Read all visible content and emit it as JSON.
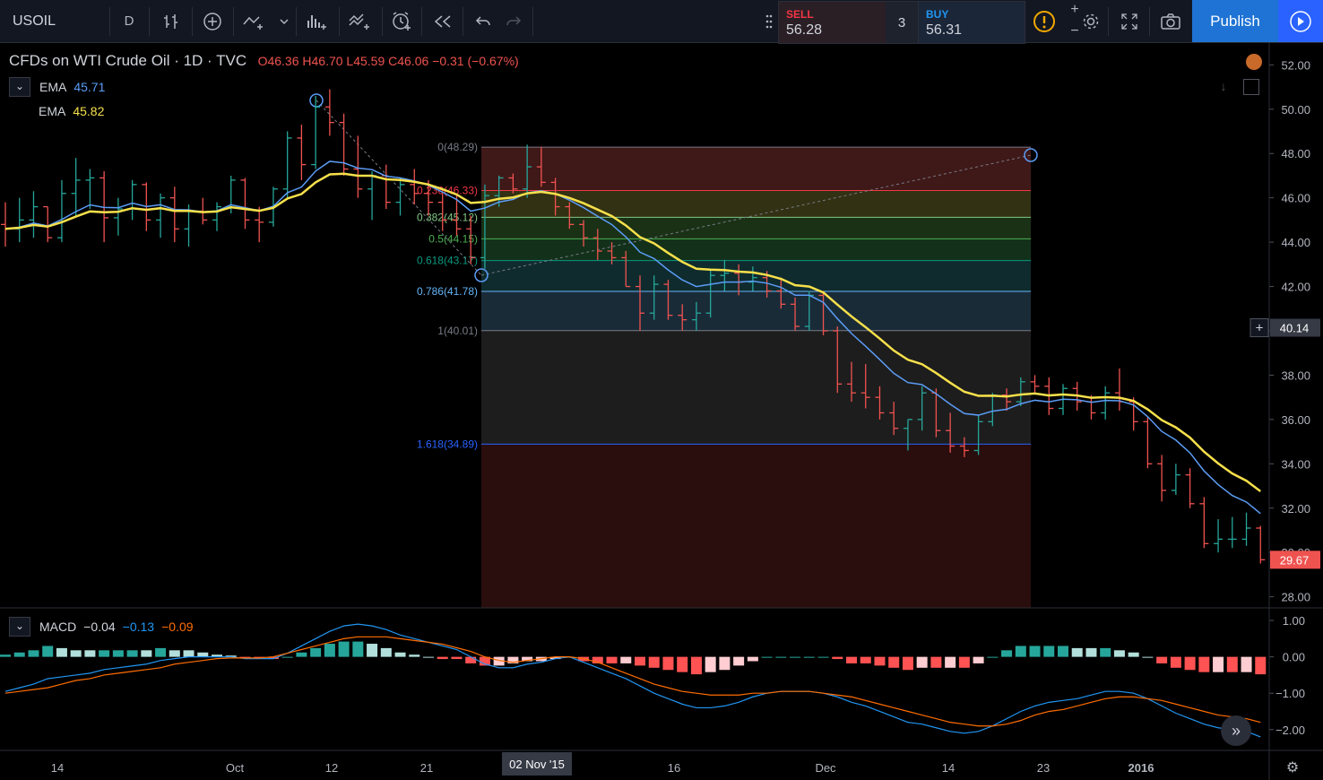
{
  "toolbar": {
    "symbol": "USOIL",
    "interval": "D",
    "sell_label": "SELL",
    "sell_price": "56.28",
    "buy_label": "BUY",
    "buy_price": "56.31",
    "quantity": "3",
    "publish_label": "Publish",
    "icons": [
      "bar-style-icon",
      "add-indicator-icon",
      "compare-icon",
      "indicators-icon",
      "templates-icon",
      "alert-icon",
      "replay-icon",
      "undo-icon",
      "redo-icon",
      "info-icon",
      "settings-icon",
      "fullscreen-icon",
      "camera-icon",
      "play-icon"
    ]
  },
  "legend": {
    "title": "CFDs on WTI Crude Oil · 1D · TVC",
    "ohlc": "O46.36 H46.70 L45.59 C46.06 −0.31 (−0.67%)",
    "ema1_label": "EMA",
    "ema1_value": "45.71",
    "ema2_label": "EMA",
    "ema2_value": "45.82",
    "macd_label": "MACD",
    "macd_v1": "−0.04",
    "macd_v2": "−0.13",
    "macd_v3": "−0.09"
  },
  "price_axis": {
    "ticks": [
      "52.00",
      "50.00",
      "48.00",
      "46.00",
      "44.00",
      "42.00",
      "40.00",
      "38.00",
      "36.00",
      "34.00",
      "32.00",
      "30.00",
      "28.00"
    ],
    "crosshair_value": "40.14",
    "last_price": "29.67"
  },
  "macd_axis": {
    "ticks": [
      "1.00",
      "0.00",
      "−1.00",
      "−2.00"
    ]
  },
  "time_axis": {
    "labels": [
      "14",
      "Oct",
      "12",
      "21",
      "16",
      "Dec",
      "14",
      "23",
      "2016"
    ],
    "highlight": "02 Nov '15"
  },
  "fib_levels": [
    {
      "label": "0(48.29)",
      "price": 48.29,
      "color": "#787b86"
    },
    {
      "label": "0.236(46.33)",
      "price": 46.33,
      "color": "#f23645"
    },
    {
      "label": "0.382(45.12)",
      "price": 45.12,
      "color": "#81c784"
    },
    {
      "label": "0.5(44.15)",
      "price": 44.15,
      "color": "#4caf50"
    },
    {
      "label": "0.618(43.17)",
      "price": 43.17,
      "color": "#089981"
    },
    {
      "label": "0.786(41.78)",
      "price": 41.78,
      "color": "#64b5f6"
    },
    {
      "label": "1(40.01)",
      "price": 40.01,
      "color": "#787b86"
    },
    {
      "label": "1.618(34.89)",
      "price": 34.89,
      "color": "#2962ff"
    }
  ],
  "colors": {
    "up": "#26a69a",
    "down": "#ef5350",
    "ema_fast": "#5b9cf6",
    "ema_slow": "#f7e04b",
    "macd_line": "#2196f3",
    "signal_line": "#ff6d00"
  },
  "chart_data": {
    "type": "bar",
    "symbol": "USOIL",
    "ylim": [
      27.5,
      52.5
    ],
    "ohlc": [
      [
        44.8,
        45.8,
        43.8,
        44.6
      ],
      [
        44.6,
        46.0,
        44.0,
        45.0
      ],
      [
        45.0,
        46.3,
        44.2,
        45.6
      ],
      [
        45.6,
        45.6,
        44.0,
        44.2
      ],
      [
        44.2,
        46.8,
        44.0,
        46.2
      ],
      [
        46.2,
        47.8,
        45.2,
        46.8
      ],
      [
        46.8,
        47.3,
        45.5,
        46.9
      ],
      [
        46.9,
        47.2,
        44.0,
        45.1
      ],
      [
        45.1,
        46.0,
        44.3,
        45.5
      ],
      [
        45.5,
        46.8,
        45.0,
        46.6
      ],
      [
        46.6,
        46.7,
        44.5,
        45.0
      ],
      [
        45.0,
        46.2,
        44.2,
        46.0
      ],
      [
        46.0,
        46.5,
        44.0,
        44.6
      ],
      [
        44.6,
        45.7,
        43.8,
        45.4
      ],
      [
        45.4,
        46.0,
        44.8,
        45.0
      ],
      [
        45.0,
        45.8,
        44.5,
        45.6
      ],
      [
        45.6,
        47.0,
        45.3,
        46.8
      ],
      [
        46.8,
        46.9,
        44.6,
        45.0
      ],
      [
        45.0,
        45.6,
        44.0,
        44.9
      ],
      [
        44.9,
        46.5,
        44.7,
        46.4
      ],
      [
        46.4,
        49.0,
        46.0,
        48.7
      ],
      [
        48.7,
        49.3,
        46.8,
        47.5
      ],
      [
        47.5,
        50.6,
        47.3,
        50.1
      ],
      [
        50.1,
        50.9,
        48.8,
        49.4
      ],
      [
        49.4,
        49.8,
        47.0,
        47.3
      ],
      [
        47.3,
        48.8,
        46.0,
        46.4
      ],
      [
        46.4,
        47.2,
        45.0,
        47.0
      ],
      [
        47.0,
        47.5,
        45.5,
        45.8
      ],
      [
        45.8,
        46.9,
        45.2,
        46.6
      ],
      [
        46.6,
        47.3,
        45.7,
        46.2
      ],
      [
        46.2,
        46.8,
        45.2,
        45.8
      ],
      [
        45.8,
        46.2,
        44.5,
        45.0
      ],
      [
        45.0,
        46.1,
        44.3,
        44.6
      ],
      [
        44.6,
        45.2,
        43.0,
        43.3
      ],
      [
        43.3,
        46.6,
        42.8,
        46.1
      ],
      [
        46.1,
        47.0,
        45.6,
        46.9
      ],
      [
        46.9,
        47.1,
        46.2,
        46.4
      ],
      [
        46.4,
        48.4,
        46.0,
        47.4
      ],
      [
        47.4,
        48.3,
        46.5,
        46.7
      ],
      [
        46.7,
        46.9,
        45.2,
        45.6
      ],
      [
        45.6,
        45.8,
        44.6,
        44.8
      ],
      [
        44.8,
        45.0,
        43.8,
        44.2
      ],
      [
        44.2,
        44.6,
        43.2,
        43.6
      ],
      [
        43.6,
        44.0,
        43.0,
        43.3
      ],
      [
        43.3,
        43.6,
        42.0,
        42.0
      ],
      [
        42.0,
        42.5,
        40.0,
        40.8
      ],
      [
        40.8,
        42.5,
        40.5,
        42.1
      ],
      [
        42.1,
        42.3,
        40.5,
        40.7
      ],
      [
        40.7,
        41.2,
        40.0,
        40.5
      ],
      [
        40.5,
        41.3,
        40.0,
        40.8
      ],
      [
        40.8,
        42.8,
        40.6,
        42.5
      ],
      [
        42.5,
        43.2,
        41.8,
        42.6
      ],
      [
        42.6,
        43.0,
        41.6,
        42.2
      ],
      [
        42.2,
        42.9,
        41.8,
        42.4
      ],
      [
        42.4,
        42.7,
        41.5,
        41.8
      ],
      [
        41.8,
        42.4,
        41.0,
        41.2
      ],
      [
        41.2,
        41.5,
        40.0,
        40.2
      ],
      [
        40.2,
        41.8,
        40.0,
        41.6
      ],
      [
        41.6,
        41.8,
        39.8,
        40.0
      ],
      [
        40.0,
        40.2,
        37.2,
        37.6
      ],
      [
        37.6,
        38.6,
        36.8,
        37.2
      ],
      [
        37.2,
        38.5,
        36.5,
        37.0
      ],
      [
        37.0,
        37.5,
        36.0,
        36.3
      ],
      [
        36.3,
        36.8,
        35.3,
        35.6
      ],
      [
        35.6,
        36.0,
        34.6,
        36.0
      ],
      [
        36.0,
        37.5,
        35.5,
        37.2
      ],
      [
        37.2,
        37.4,
        35.2,
        35.5
      ],
      [
        35.5,
        36.3,
        34.5,
        34.8
      ],
      [
        34.8,
        35.2,
        34.3,
        34.6
      ],
      [
        34.6,
        36.2,
        34.4,
        35.9
      ],
      [
        35.9,
        37.2,
        35.7,
        37.1
      ],
      [
        37.1,
        37.4,
        36.4,
        36.8
      ],
      [
        36.8,
        37.9,
        36.6,
        37.7
      ],
      [
        37.7,
        38.0,
        37.2,
        37.5
      ],
      [
        37.5,
        37.9,
        36.2,
        36.5
      ],
      [
        36.5,
        37.6,
        36.2,
        37.4
      ],
      [
        37.4,
        37.7,
        36.4,
        36.8
      ],
      [
        36.8,
        37.1,
        36.0,
        36.3
      ],
      [
        36.3,
        37.5,
        36.0,
        37.2
      ],
      [
        37.2,
        38.3,
        36.4,
        36.8
      ],
      [
        36.8,
        37.0,
        35.5,
        35.9
      ],
      [
        35.9,
        36.1,
        33.8,
        34.0
      ],
      [
        34.0,
        34.4,
        32.3,
        32.8
      ],
      [
        32.8,
        34.0,
        32.6,
        33.5
      ],
      [
        33.5,
        33.8,
        32.0,
        32.2
      ],
      [
        32.2,
        32.5,
        30.2,
        30.4
      ],
      [
        30.4,
        31.5,
        30.0,
        30.6
      ],
      [
        30.6,
        31.6,
        30.2,
        30.6
      ],
      [
        30.6,
        31.8,
        30.3,
        31.1
      ],
      [
        31.1,
        31.2,
        29.5,
        29.67
      ]
    ],
    "ema_fast_end": 45.71,
    "ema_slow_end": 45.82,
    "macd": {
      "ylim": [
        -2.4,
        1.1
      ],
      "macd_line": [
        -0.95,
        -0.85,
        -0.75,
        -0.6,
        -0.55,
        -0.5,
        -0.45,
        -0.35,
        -0.3,
        -0.25,
        -0.2,
        -0.1,
        -0.05,
        0.0,
        0.0,
        0.0,
        0.0,
        -0.05,
        -0.05,
        -0.05,
        0.1,
        0.3,
        0.5,
        0.7,
        0.85,
        0.9,
        0.85,
        0.75,
        0.6,
        0.5,
        0.4,
        0.3,
        0.2,
        0.0,
        -0.2,
        -0.3,
        -0.3,
        -0.2,
        -0.15,
        -0.05,
        0.0,
        -0.15,
        -0.3,
        -0.45,
        -0.6,
        -0.8,
        -1.0,
        -1.15,
        -1.3,
        -1.4,
        -1.4,
        -1.35,
        -1.25,
        -1.1,
        -1.0,
        -0.95,
        -0.95,
        -0.95,
        -1.0,
        -1.1,
        -1.25,
        -1.35,
        -1.5,
        -1.65,
        -1.8,
        -1.85,
        -1.95,
        -2.05,
        -2.1,
        -2.05,
        -1.9,
        -1.7,
        -1.5,
        -1.35,
        -1.25,
        -1.2,
        -1.15,
        -1.05,
        -0.95,
        -0.95,
        -1.0,
        -1.15,
        -1.35,
        -1.55,
        -1.7,
        -1.85,
        -1.95,
        -2.0,
        -2.05,
        -2.2
      ],
      "signal_line": [
        -1.0,
        -0.95,
        -0.9,
        -0.85,
        -0.75,
        -0.65,
        -0.6,
        -0.5,
        -0.45,
        -0.4,
        -0.35,
        -0.3,
        -0.2,
        -0.15,
        -0.1,
        -0.05,
        -0.03,
        -0.03,
        -0.03,
        0.0,
        0.1,
        0.2,
        0.3,
        0.4,
        0.5,
        0.55,
        0.55,
        0.55,
        0.5,
        0.45,
        0.4,
        0.35,
        0.25,
        0.15,
        0.0,
        -0.1,
        -0.15,
        -0.1,
        -0.05,
        0.0,
        0.0,
        -0.05,
        -0.15,
        -0.3,
        -0.45,
        -0.6,
        -0.75,
        -0.85,
        -0.95,
        -1.0,
        -1.05,
        -1.05,
        -1.05,
        -1.0,
        -1.0,
        -0.95,
        -0.95,
        -0.95,
        -1.0,
        -1.05,
        -1.1,
        -1.2,
        -1.3,
        -1.4,
        -1.5,
        -1.6,
        -1.7,
        -1.8,
        -1.85,
        -1.9,
        -1.9,
        -1.85,
        -1.75,
        -1.6,
        -1.5,
        -1.45,
        -1.35,
        -1.25,
        -1.15,
        -1.1,
        -1.1,
        -1.15,
        -1.2,
        -1.3,
        -1.4,
        -1.5,
        -1.6,
        -1.65,
        -1.7,
        -1.8
      ]
    }
  }
}
